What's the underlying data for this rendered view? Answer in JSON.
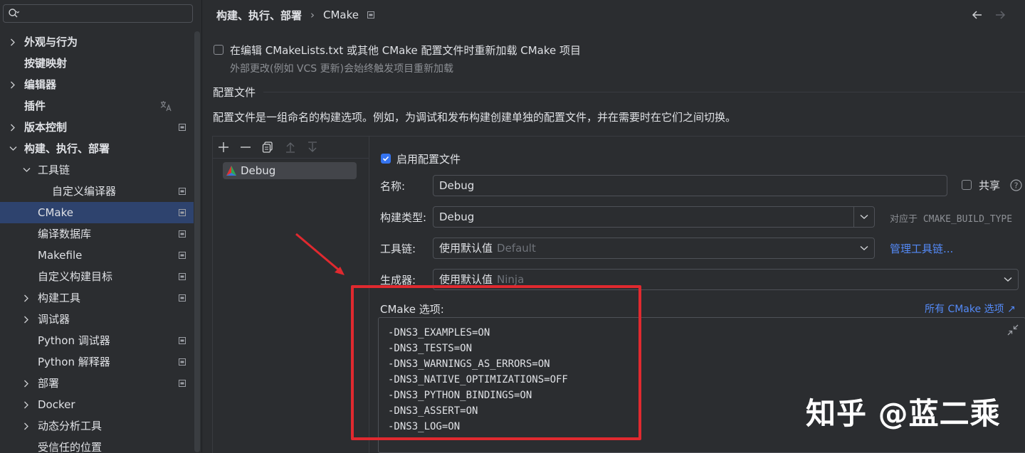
{
  "sidebar": {
    "search": {
      "value": ""
    },
    "items": [
      {
        "label": "外观与行为",
        "bold": true,
        "level": 0,
        "chevron": "right"
      },
      {
        "label": "按键映射",
        "bold": true,
        "level": 0
      },
      {
        "label": "编辑器",
        "bold": true,
        "level": 0,
        "chevron": "right"
      },
      {
        "label": "插件",
        "bold": true,
        "level": 0,
        "trans": true
      },
      {
        "label": "版本控制",
        "bold": true,
        "level": 0,
        "chevron": "right",
        "mark": true
      },
      {
        "label": "构建、执行、部署",
        "bold": true,
        "level": 0,
        "chevron": "down"
      },
      {
        "label": "工具链",
        "level": 1,
        "chevron": "down"
      },
      {
        "label": "自定义编译器",
        "level": 2,
        "mark": true
      },
      {
        "label": "CMake",
        "level": 1,
        "selected": true,
        "mark": true
      },
      {
        "label": "编译数据库",
        "level": 1,
        "mark": true
      },
      {
        "label": "Makefile",
        "level": 1,
        "mark": true
      },
      {
        "label": "自定义构建目标",
        "level": 1,
        "mark": true
      },
      {
        "label": "构建工具",
        "level": 1,
        "chevron": "right",
        "mark": true
      },
      {
        "label": "调试器",
        "level": 1,
        "chevron": "right"
      },
      {
        "label": "Python 调试器",
        "level": 1,
        "mark": true
      },
      {
        "label": "Python 解释器",
        "level": 1,
        "mark": true
      },
      {
        "label": "部署",
        "level": 1,
        "chevron": "right",
        "mark": true
      },
      {
        "label": "Docker",
        "level": 1,
        "chevron": "right"
      },
      {
        "label": "动态分析工具",
        "level": 1,
        "chevron": "right"
      },
      {
        "label": "受信任的位置",
        "level": 1
      }
    ]
  },
  "breadcrumb": {
    "parent": "构建、执行、部署",
    "sep": "›",
    "current": "CMake"
  },
  "reload": {
    "label": "在编辑 CMakeLists.txt 或其他 CMake 配置文件时重新加载 CMake 项目",
    "hint": "外部更改(例如 VCS 更新)会始终触发项目重新加载"
  },
  "profiles": {
    "section_title": "配置文件",
    "description": "配置文件是一组命名的构建选项。例如，为调试和发布构建创建单独的配置文件，并在需要时在它们之间切换。",
    "list": [
      "Debug"
    ]
  },
  "form": {
    "enable_label": "启用配置文件",
    "name_label": "名称:",
    "name_value": "Debug",
    "share_label": "共享",
    "build_type_label": "构建类型:",
    "build_type_value": "Debug",
    "build_type_hint": "对应于 CMAKE_BUILD_TYPE",
    "toolchain_label": "工具链:",
    "toolchain_value": "使用默认值",
    "toolchain_dim": "Default",
    "toolchain_link": "管理工具链...",
    "generator_label": "生成器:",
    "generator_value": "使用默认值",
    "generator_dim": "Ninja",
    "cmake_options_label": "CMake 选项:",
    "cmake_options_link": "所有 CMake 选项",
    "cmake_options_lines": [
      "-DNS3_EXAMPLES=ON",
      "-DNS3_TESTS=ON",
      "-DNS3_WARNINGS_AS_ERRORS=ON",
      "-DNS3_NATIVE_OPTIMIZATIONS=OFF",
      "-DNS3_PYTHON_BINDINGS=ON",
      "-DNS3_ASSERT=ON",
      "-DNS3_LOG=ON"
    ]
  },
  "watermark": "知乎 @蓝二乘",
  "colors": {
    "accent": "#3574f0",
    "link": "#548af7",
    "annotation": "#e0292f",
    "selection": "#2e436e"
  }
}
